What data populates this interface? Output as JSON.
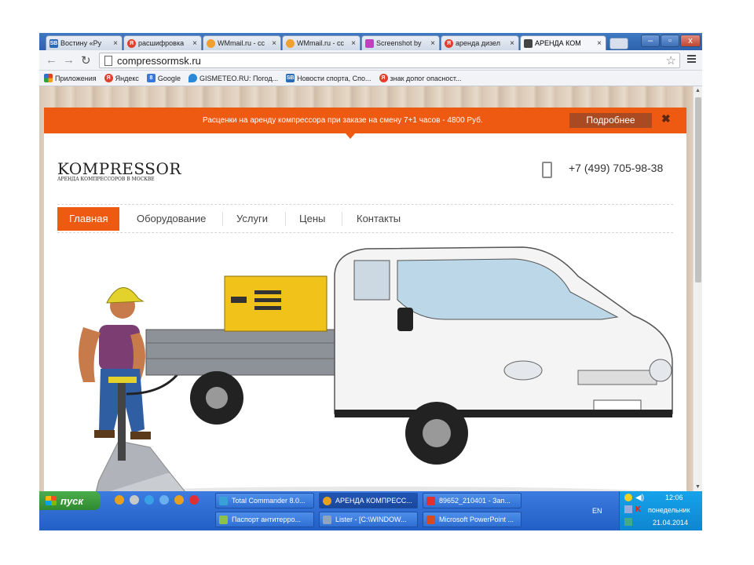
{
  "tabs": [
    {
      "title": "Вoстину «Ру",
      "icon_color": "#2a6bb8",
      "icon_text": "SB"
    },
    {
      "title": "расшифровка",
      "icon_color": "#e0402b",
      "icon_text": "Я"
    },
    {
      "title": "WMmail.ru - сс",
      "icon_color": "#f0a030",
      "icon_text": ""
    },
    {
      "title": "WMmail.ru - сс",
      "icon_color": "#f0a030",
      "icon_text": ""
    },
    {
      "title": "Screenshot by",
      "icon_color": "#c040c0",
      "icon_text": ""
    },
    {
      "title": "аренда дизел",
      "icon_color": "#e0402b",
      "icon_text": "Я"
    },
    {
      "title": "АРЕНДА КОМ",
      "icon_color": "#444444",
      "icon_text": ""
    }
  ],
  "window_buttons": {
    "minimize": "–",
    "maximize": "▫",
    "close": "x"
  },
  "address": {
    "url": "compressormsk.ru"
  },
  "bookmarks": [
    {
      "label": "Приложения",
      "icon_color": "#d04020",
      "icon_text": ""
    },
    {
      "label": "Яндекс",
      "icon_color": "#e0402b",
      "icon_text": "Я"
    },
    {
      "label": "Google",
      "icon_color": "#3a78d8",
      "icon_text": "8"
    },
    {
      "label": "GISMETEO.RU: Погод...",
      "icon_color": "#2a8ad8",
      "icon_text": ""
    },
    {
      "label": "Новости спорта, Спо...",
      "icon_color": "#2a6bb8",
      "icon_text": "SB"
    },
    {
      "label": "знак допог опасност...",
      "icon_color": "#e0402b",
      "icon_text": "Я"
    }
  ],
  "site": {
    "promo_text": "Расценки на аренду компрессора при заказе на смену 7+1 часов - 4800 Руб.",
    "promo_button": "Подробнее",
    "promo_close": "✖",
    "logo": "KOMPRESSOR",
    "logo_sub": "АРЕНДА КОМПРЕССОРОВ В МОСКВЕ",
    "phone": "+7 (499) 705-98-38",
    "nav": [
      "Главная",
      "Оборудование",
      "Услуги",
      "Цены",
      "Контакты"
    ],
    "accent": "#ee5a12"
  },
  "taskbar": {
    "start": "пуск",
    "tasks": [
      {
        "label": "Total Commander 8.0...",
        "icon_color": "#3aa0d8"
      },
      {
        "label": "АРЕНДА КОМПРЕСС...",
        "icon_color": "#e8a020"
      },
      {
        "label": "89652_210401 - Зап...",
        "icon_color": "#e03030"
      },
      {
        "label": "Паспорт антитерро...",
        "icon_color": "#8bc34a"
      },
      {
        "label": "Lister - [C:\\WINDOW...",
        "icon_color": "#90a4c0"
      },
      {
        "label": "Microsoft PowerPoint ...",
        "icon_color": "#d84a20"
      }
    ],
    "lang": "EN",
    "time": "12:06",
    "day": "понедельник",
    "date": "21.04.2014"
  }
}
